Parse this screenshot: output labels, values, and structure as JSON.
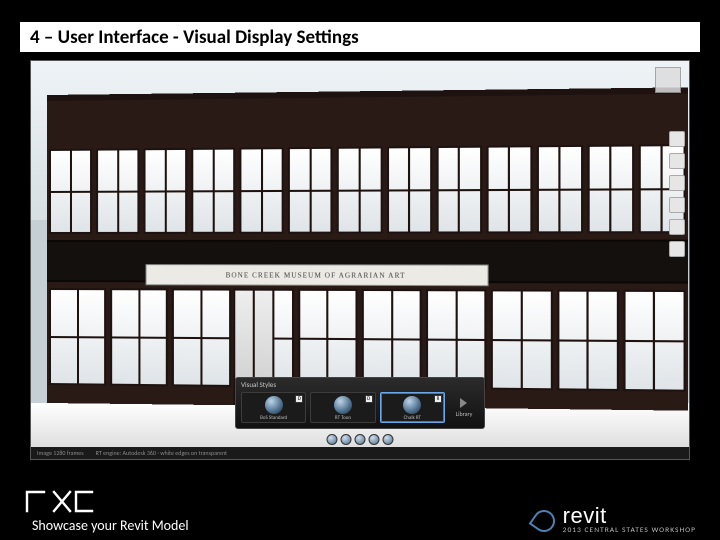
{
  "title": {
    "section": "4 – User Interface",
    "separator": " - ",
    "topic": "Visual Display Settings"
  },
  "building_sign": "BONE CREEK MUSEUM OF AGRARIAN ART",
  "visual_styles_panel": {
    "label": "Visual Styles",
    "side_label": "Library",
    "items": [
      {
        "chip": "D",
        "label": "BoS Standard"
      },
      {
        "chip": "D",
        "label": "RT Toon"
      },
      {
        "chip": "R",
        "label": "Chalk RT",
        "selected": true
      }
    ]
  },
  "status": {
    "left": "Image 1280 frames",
    "center": "RT engine: Autodesk 360 · white edges on transparent"
  },
  "footer": {
    "caption": "Showcase your Revit Model",
    "right_product": "revit",
    "right_sub": "2013 CENTRAL STATES WORKSHOP"
  }
}
